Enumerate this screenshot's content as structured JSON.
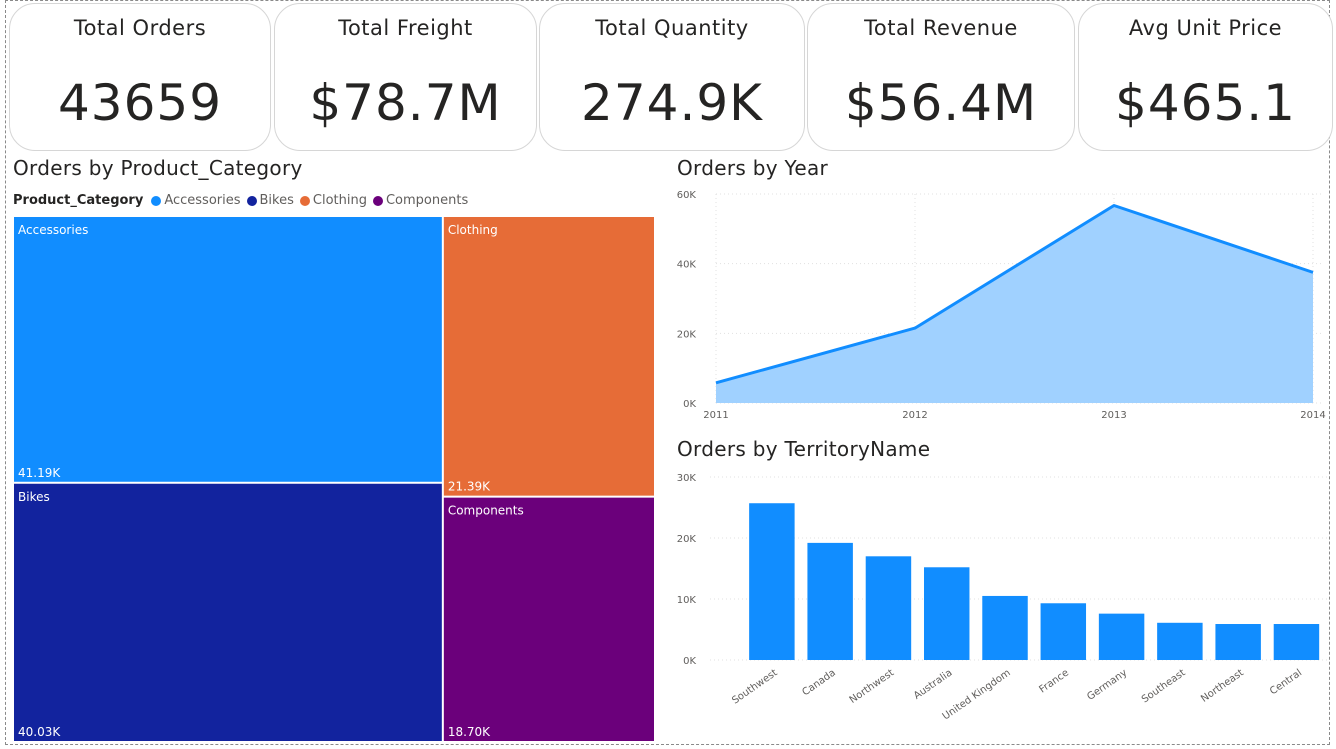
{
  "kpis": [
    {
      "title": "Total Orders",
      "value": "43659"
    },
    {
      "title": "Total Freight",
      "value": "$78.7M"
    },
    {
      "title": "Total Quantity",
      "value": "274.9K"
    },
    {
      "title": "Total Revenue",
      "value": "$56.4M"
    },
    {
      "title": "Avg Unit Price",
      "value": "$465.1"
    }
  ],
  "chart_data": [
    {
      "type": "treemap",
      "title": "Orders by Product_Category",
      "legend_title": "Product_Category",
      "legend_position": "top-left",
      "categories": [
        "Accessories",
        "Bikes",
        "Clothing",
        "Components"
      ],
      "values": [
        41190,
        40030,
        21390,
        18700
      ],
      "value_labels": [
        "41.19K",
        "40.03K",
        "21.39K",
        "18.70K"
      ],
      "colors": [
        "#118DFF",
        "#12239E",
        "#E66C37",
        "#6B007B"
      ]
    },
    {
      "type": "area",
      "title": "Orders by Year",
      "x": [
        "2011",
        "2012",
        "2013",
        "2014"
      ],
      "values": [
        5800,
        21500,
        56700,
        37500
      ],
      "ylim": [
        0,
        60000
      ],
      "yticks": [
        0,
        20000,
        40000,
        60000
      ],
      "ytick_labels": [
        "0K",
        "20K",
        "40K",
        "60K"
      ],
      "grid": true,
      "line_color": "#118DFF",
      "fill_color": "#A0D1FF"
    },
    {
      "type": "bar",
      "title": "Orders by TerritoryName",
      "categories": [
        "Southwest",
        "Canada",
        "Northwest",
        "Australia",
        "United Kingdom",
        "France",
        "Germany",
        "Southeast",
        "Northeast",
        "Central"
      ],
      "values": [
        25700,
        19200,
        17000,
        15200,
        10500,
        9300,
        7600,
        6100,
        5900,
        5900
      ],
      "ylim": [
        0,
        30000
      ],
      "yticks": [
        0,
        10000,
        20000,
        30000
      ],
      "ytick_labels": [
        "0K",
        "10K",
        "20K",
        "30K"
      ],
      "grid": true,
      "bar_color": "#118DFF"
    }
  ]
}
